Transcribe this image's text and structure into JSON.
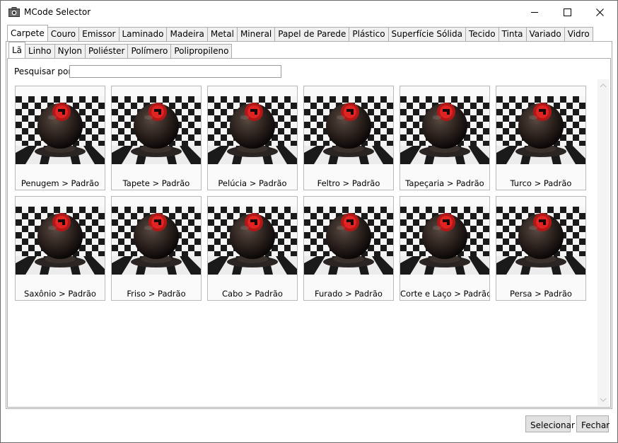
{
  "window": {
    "title": "MCode Selector",
    "controls": {
      "minimize": "minimize-icon",
      "maximize": "maximize-icon",
      "close": "close-icon"
    }
  },
  "category_tabs": [
    "Carpete",
    "Couro",
    "Emissor",
    "Laminado",
    "Madeira",
    "Metal",
    "Mineral",
    "Papel de Parede",
    "Plástico",
    "Superfície Sólida",
    "Tecido",
    "Tinta",
    "Variado",
    "Vidro"
  ],
  "category_selected": "Carpete",
  "subcategory_tabs": [
    "Lã",
    "Linho",
    "Nylon",
    "Poliéster",
    "Polímero",
    "Polipropileno"
  ],
  "subcategory_selected": "Lã",
  "search": {
    "label": "Pesquisar por:",
    "value": "",
    "placeholder": ""
  },
  "materials": [
    {
      "label": "Penugem > Padrão"
    },
    {
      "label": "Tapete > Padrão"
    },
    {
      "label": "Pelúcia > Padrão"
    },
    {
      "label": "Feltro > Padrão"
    },
    {
      "label": "Tapeçaria > Padrão"
    },
    {
      "label": "Turco > Padrão"
    },
    {
      "label": "Saxônio > Padrão"
    },
    {
      "label": "Friso > Padrão"
    },
    {
      "label": "Cabo > Padrão"
    },
    {
      "label": "Furado > Padrão"
    },
    {
      "label": "Corte e Laço > Padrão"
    },
    {
      "label": "Persa > Padrão"
    }
  ],
  "buttons": {
    "select": "Selecionar",
    "close": "Fechar"
  }
}
